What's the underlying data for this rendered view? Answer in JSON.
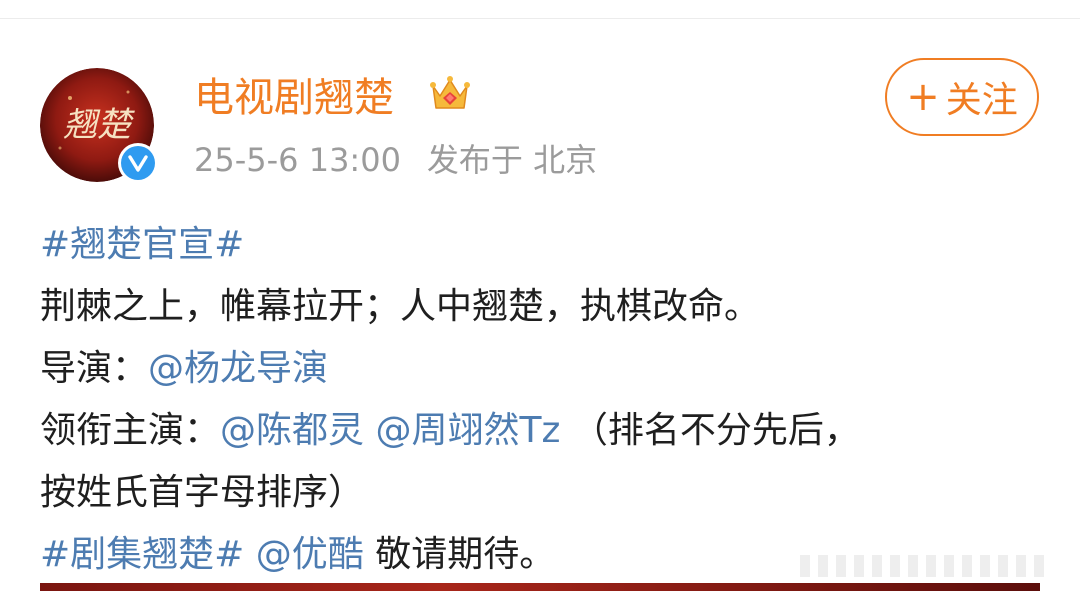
{
  "author": {
    "name": "电视剧翘楚",
    "avatar_text": "翘楚",
    "badge_icon": "crown-badge-icon",
    "verified_icon": "verified-v-icon"
  },
  "meta": {
    "time": "25-5-6 13:00",
    "location": "发布于 北京"
  },
  "follow": {
    "plus": "+",
    "label": "关注"
  },
  "post": {
    "hashtag1": "#翘楚官宣#",
    "line2": "荆棘之上，帷幕拉开；人中翘楚，执棋改命。",
    "director_label": "导演：",
    "director_link": "@杨龙导演",
    "lead_label": "领衔主演：",
    "lead_link1": "@陈都灵",
    "lead_link2": "@周翊然Tz",
    "note_part1": "（排名不分先后，",
    "note_part2": "按姓氏首字母排序）",
    "hashtag2": "#剧集翘楚#",
    "platform_link": "@优酷",
    "closing": "敬请期待。"
  },
  "colors": {
    "accent": "#f07d23",
    "link": "#4d7cb1",
    "text": "#1f1f1f",
    "meta": "#9b9b9b",
    "verified": "#2f9bf0"
  }
}
